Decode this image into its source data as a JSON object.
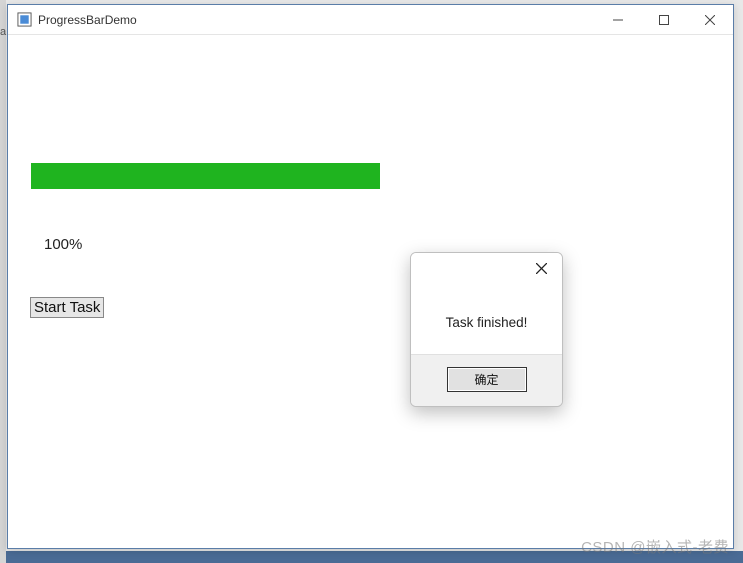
{
  "window": {
    "title": "ProgressBarDemo"
  },
  "progress": {
    "percent_text": "100%",
    "value": 100,
    "color": "#1fb41f"
  },
  "buttons": {
    "start_task": "Start Task"
  },
  "dialog": {
    "message": "Task finished!",
    "ok_label": "确定"
  },
  "watermark": "CSDN @嵌入式-老费",
  "left_edge_char": "a"
}
